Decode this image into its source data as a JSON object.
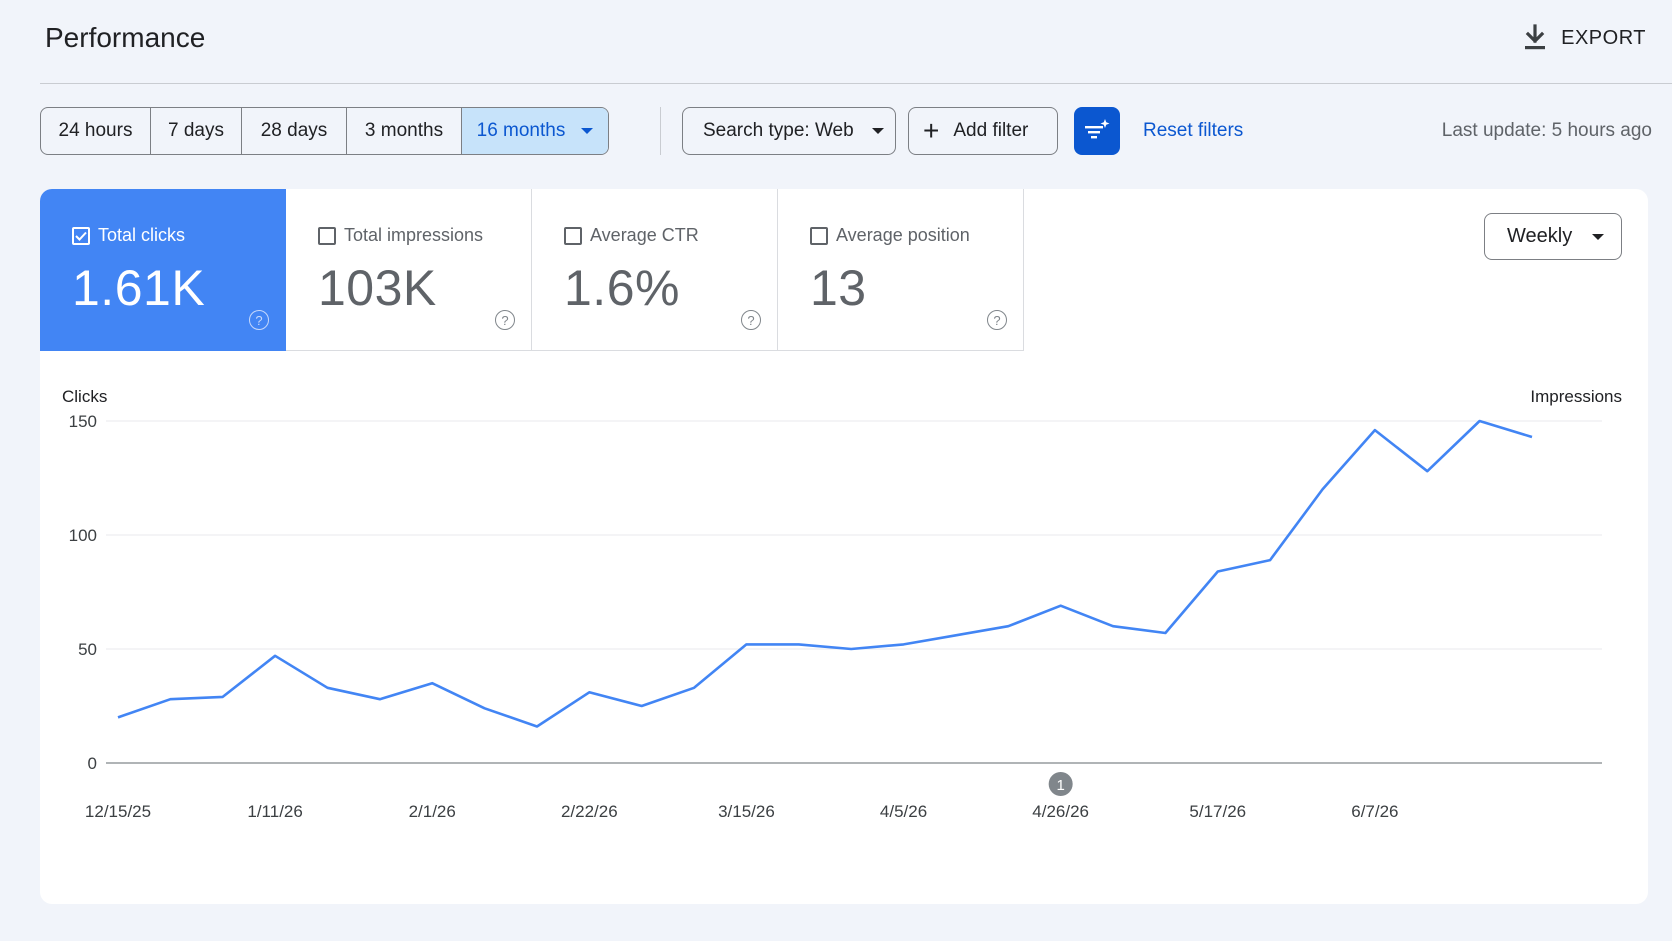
{
  "header": {
    "title": "Performance",
    "export_label": "EXPORT"
  },
  "toolbar": {
    "ranges": [
      {
        "label": "24 hours",
        "active": false
      },
      {
        "label": "7 days",
        "active": false
      },
      {
        "label": "28 days",
        "active": false
      },
      {
        "label": "3 months",
        "active": false
      },
      {
        "label": "16 months",
        "active": true
      }
    ],
    "search_type": "Search type: Web",
    "add_filter": "Add filter",
    "reset_filters": "Reset filters",
    "last_update": "Last update: 5 hours ago"
  },
  "metrics": [
    {
      "label": "Total clicks",
      "value": "1.61K",
      "checked": true
    },
    {
      "label": "Total impressions",
      "value": "103K",
      "checked": false
    },
    {
      "label": "Average CTR",
      "value": "1.6%",
      "checked": false
    },
    {
      "label": "Average position",
      "value": "13",
      "checked": false
    }
  ],
  "granularity": "Weekly",
  "colors": {
    "accent": "#0b57d0",
    "tile_active": "#4285f4",
    "line": "#4285f4",
    "annotation": "#80868b"
  },
  "chart_data": {
    "type": "line",
    "ylabel_left": "Clicks",
    "ylabel_right": "Impressions",
    "ylim": [
      0,
      150
    ],
    "yticks": [
      0,
      50,
      100,
      150
    ],
    "grid": true,
    "xtick_labels": [
      "12/15/25",
      "1/11/26",
      "2/1/26",
      "2/22/26",
      "3/15/26",
      "4/5/26",
      "4/26/26",
      "5/17/26",
      "6/7/26"
    ],
    "series": [
      {
        "values": [
          20,
          28,
          29,
          47,
          33,
          28,
          35,
          24,
          16,
          31,
          25,
          33,
          52,
          52,
          50,
          52,
          56,
          60,
          69,
          60,
          57,
          84,
          89,
          120,
          146,
          128,
          150,
          143
        ]
      }
    ],
    "annotations": [
      {
        "label": "1",
        "index": 18
      }
    ]
  }
}
